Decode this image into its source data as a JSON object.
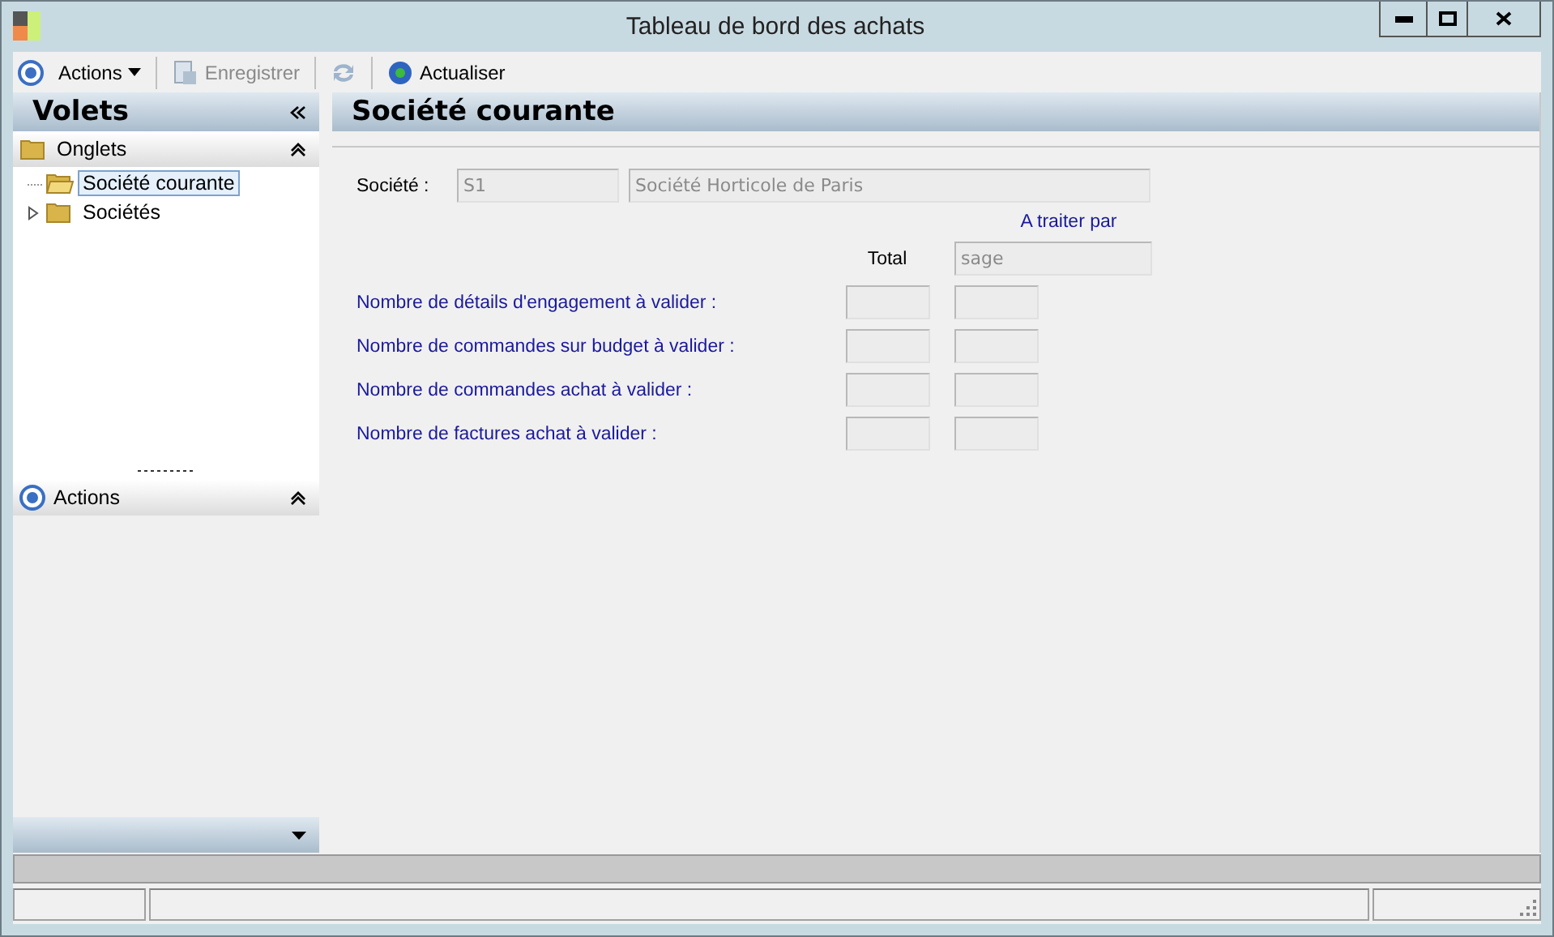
{
  "window": {
    "title": "Tableau de bord des achats"
  },
  "toolbar": [
    {
      "kind": "menu",
      "label": "Actions",
      "disabled": false
    },
    {
      "kind": "button",
      "label": "Enregistrer",
      "disabled": true
    },
    {
      "kind": "icon",
      "disabled": true
    },
    {
      "kind": "button",
      "label": "Actualiser",
      "disabled": false
    }
  ],
  "sidebar": {
    "title": "Volets",
    "sections": [
      {
        "title": "Onglets",
        "expanded": true,
        "items": [
          {
            "label": "Société courante",
            "kind": "leaf",
            "selected": true
          },
          {
            "label": "Sociétés",
            "kind": "folder",
            "selected": false,
            "expanded": false
          }
        ]
      },
      {
        "title": "Actions",
        "expanded": true
      }
    ]
  },
  "main": {
    "title": "Société courante",
    "company": {
      "label": "Société :",
      "code": "S1",
      "name": "Société Horticole de Paris"
    },
    "column_headers": {
      "total": "Total",
      "handler": "A traiter par",
      "handler_value": "sage"
    },
    "rows": [
      {
        "label": "Nombre de détails d'engagement à valider :"
      },
      {
        "label": "Nombre de commandes sur budget à valider :"
      },
      {
        "label": "Nombre de commandes achat à valider :"
      },
      {
        "label": "Nombre de factures achat à valider :"
      }
    ]
  }
}
